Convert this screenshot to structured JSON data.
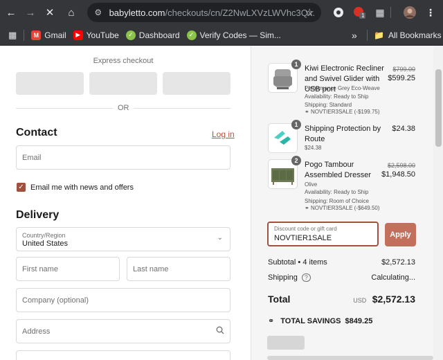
{
  "browser": {
    "url_domain": "babyletto.com",
    "url_path": "/checkouts/cn/Z2NwLXVzLWVhc3Qx...",
    "bookmarks": [
      {
        "label": "Gmail",
        "icon": "gmail-icon",
        "color": "#ea4335"
      },
      {
        "label": "YouTube",
        "icon": "youtube-icon",
        "color": "#ff0000"
      },
      {
        "label": "Dashboard",
        "icon": "dashboard-icon",
        "color": "#8bc34a"
      },
      {
        "label": "Verify Codes — Sim...",
        "icon": "verify-icon",
        "color": "#8bc34a"
      }
    ],
    "all_bookmarks": "All Bookmarks",
    "more_bookmarks": "»",
    "ext_badge": "1"
  },
  "checkout": {
    "express_label": "Express checkout",
    "or_text": "OR",
    "contact_heading": "Contact",
    "login_link": "Log in",
    "email_placeholder": "Email",
    "newsletter_label": "Email me with news and offers",
    "delivery_heading": "Delivery",
    "country_label": "Country/Region",
    "country_value": "United States",
    "first_name_placeholder": "First name",
    "last_name_placeholder": "Last name",
    "company_placeholder": "Company (optional)",
    "address_placeholder": "Address"
  },
  "summary": {
    "items": [
      {
        "qty": "1",
        "name": "Kiwi Electronic Recliner and Swivel Glider with USB port",
        "meta": [
          "Performance Grey Eco-Weave",
          "Availability: Ready to Ship",
          "Shipping: Standard",
          "NOVTIER3SALE (-$199.75)"
        ],
        "old_price": "$799.00",
        "price": "$599.25"
      },
      {
        "qty": "1",
        "name": "Shipping Protection by Route",
        "meta": [
          "$24.38"
        ],
        "old_price": "",
        "price": "$24.38"
      },
      {
        "qty": "2",
        "name": "Pogo Tambour Assembled Dresser",
        "meta": [
          "Olive",
          "Availability: Ready to Ship",
          "Shipping: Room of Choice",
          "NOVTIER3SALE (-$649.50)"
        ],
        "old_price": "$2,598.00",
        "price": "$1,948.50"
      }
    ],
    "discount_label": "Discount code or gift card",
    "discount_value": "NOVTIER1SALE",
    "apply_label": "Apply",
    "subtotal_label": "Subtotal • 4 items",
    "subtotal_value": "$2,572.13",
    "shipping_label": "Shipping",
    "shipping_value": "Calculating...",
    "total_label": "Total",
    "total_currency": "USD",
    "total_value": "$2,572.13",
    "savings_label": "TOTAL SAVINGS",
    "savings_value": "$849.25"
  },
  "colors": {
    "accent": "#a0503e",
    "apply_bg": "#c2705c"
  }
}
